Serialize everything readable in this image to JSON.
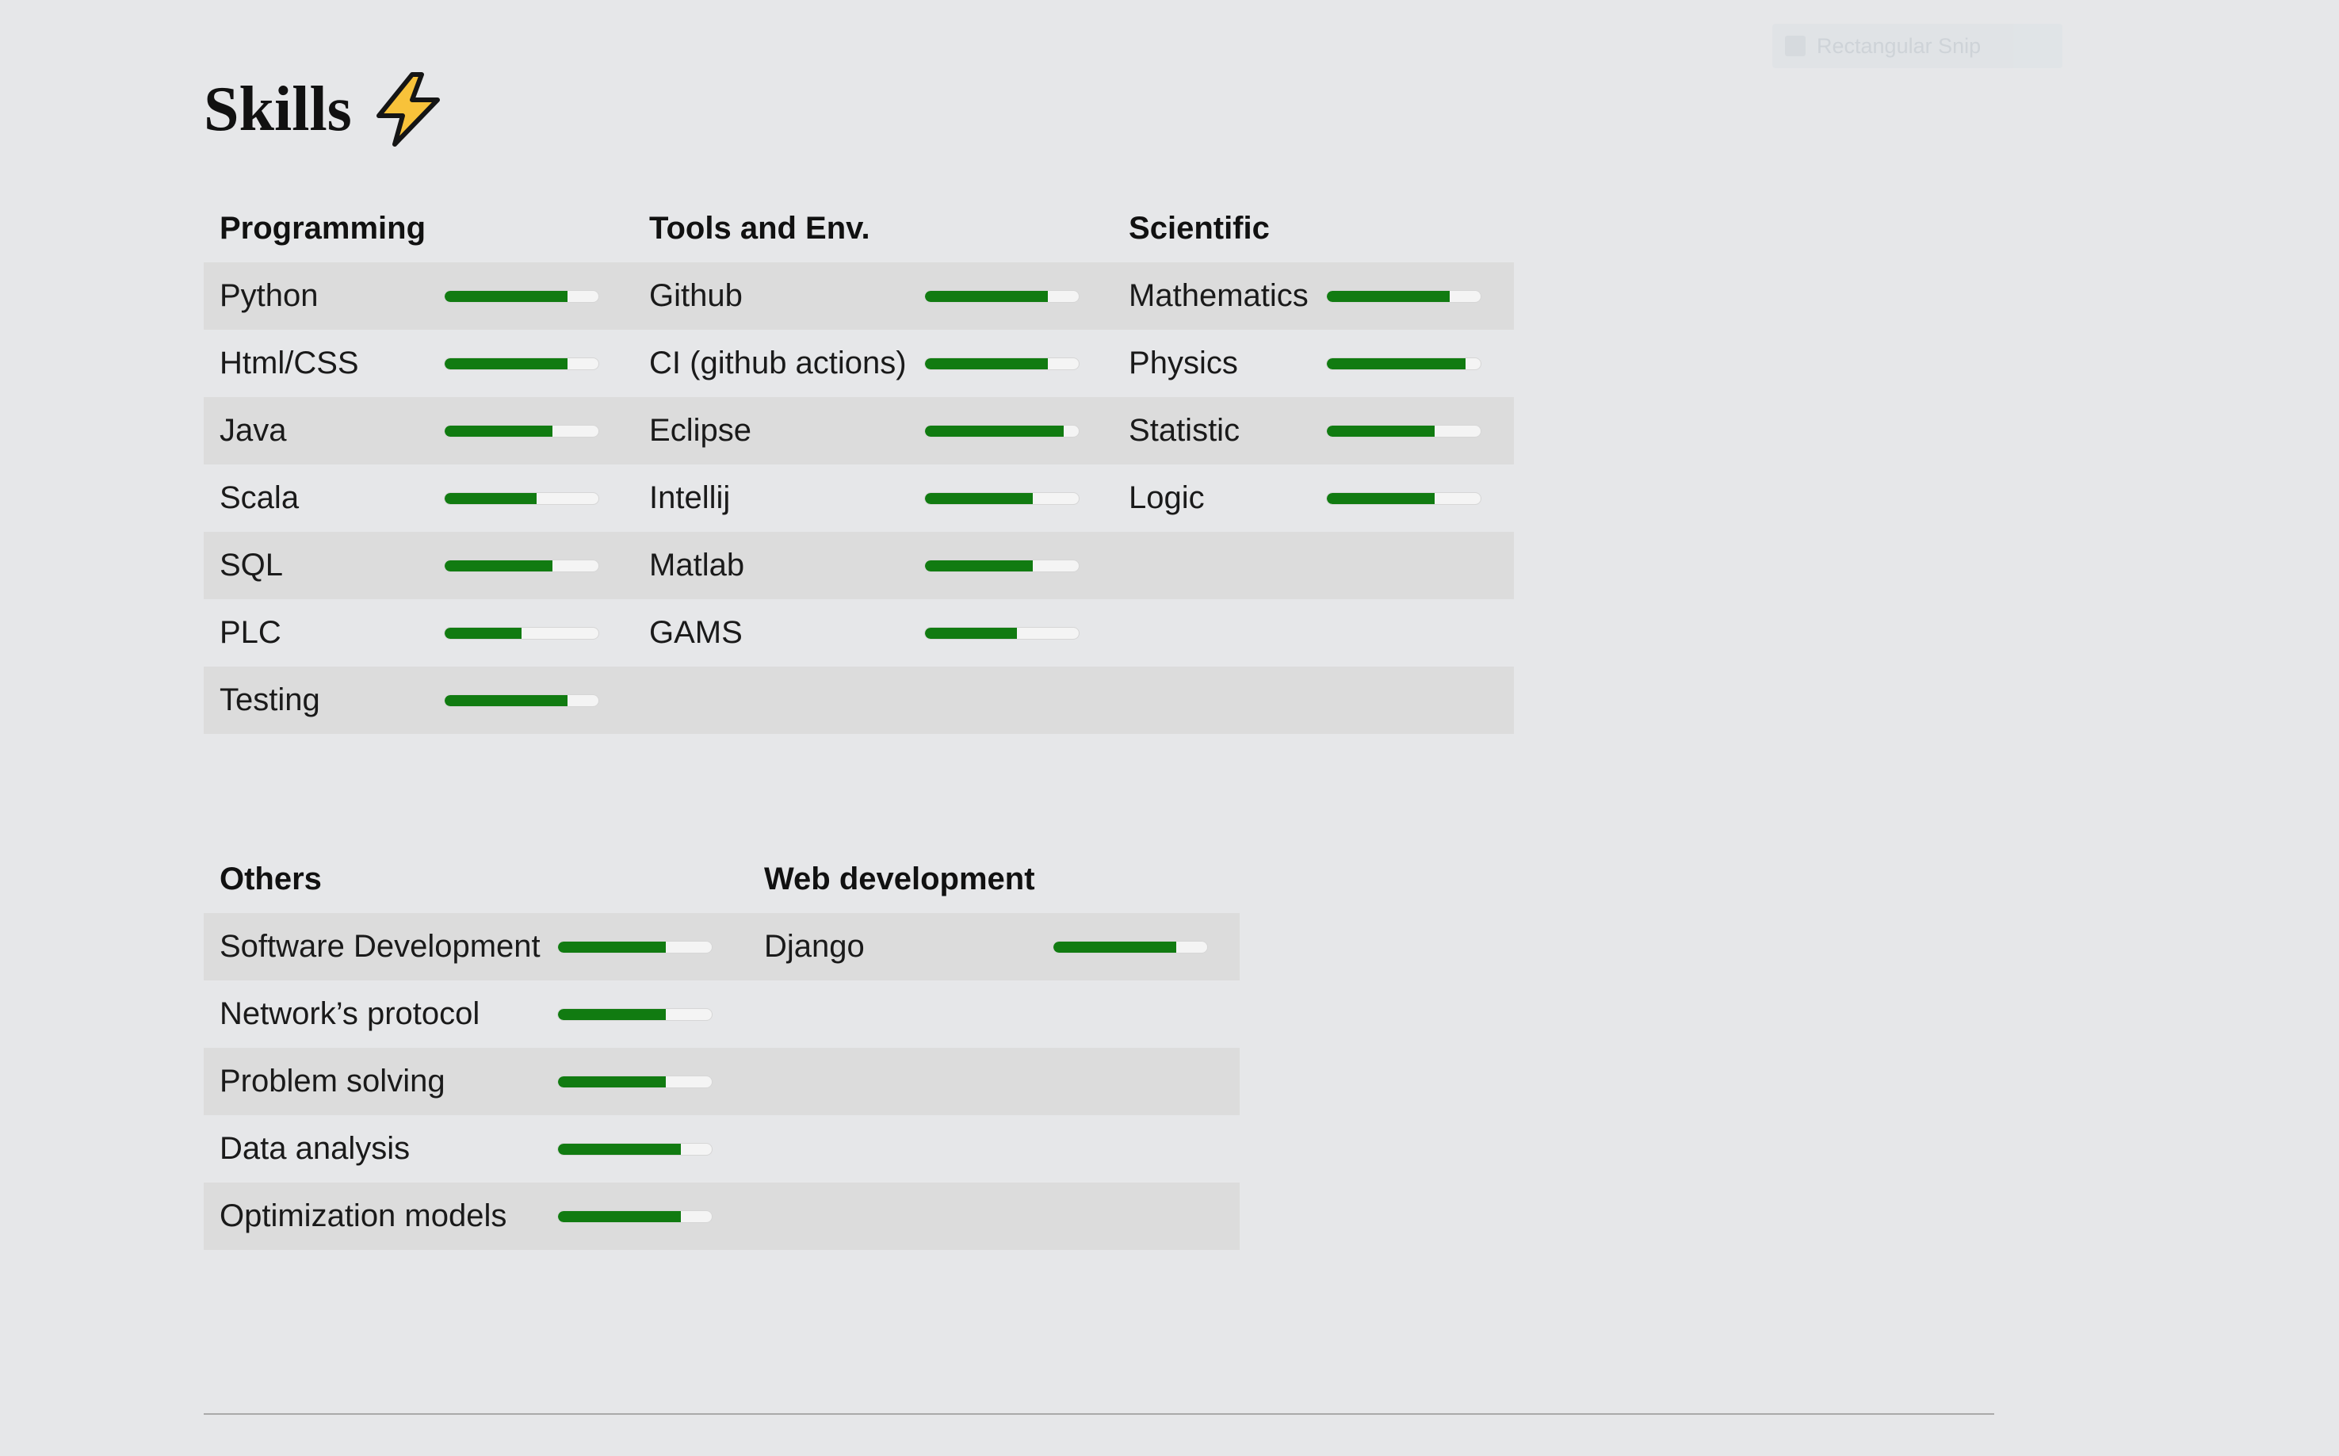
{
  "overlay": {
    "label": "Rectangular Snip"
  },
  "heading": {
    "title": "Skills",
    "icon": "lightning-bolt-icon"
  },
  "colors": {
    "bar_fill": "#117b11",
    "bar_track": "#f4f4f4",
    "background": "#e6e7e9",
    "row_shade": "#dcdcdc"
  },
  "groups_top": {
    "programming": {
      "title": "Programming",
      "skills": [
        {
          "name": "Python",
          "level": 0.8
        },
        {
          "name": "Html/CSS",
          "level": 0.8
        },
        {
          "name": "Java",
          "level": 0.7
        },
        {
          "name": "Scala",
          "level": 0.6
        },
        {
          "name": "SQL",
          "level": 0.7
        },
        {
          "name": "PLC",
          "level": 0.5
        },
        {
          "name": "Testing",
          "level": 0.8
        }
      ]
    },
    "tools": {
      "title": "Tools and Env.",
      "skills": [
        {
          "name": "Github",
          "level": 0.8
        },
        {
          "name": "CI (github actions)",
          "level": 0.8
        },
        {
          "name": "Eclipse",
          "level": 0.9
        },
        {
          "name": "Intellij",
          "level": 0.7
        },
        {
          "name": "Matlab",
          "level": 0.7
        },
        {
          "name": "GAMS",
          "level": 0.6
        }
      ]
    },
    "scientific": {
      "title": "Scientific",
      "skills": [
        {
          "name": "Mathematics",
          "level": 0.8
        },
        {
          "name": "Physics",
          "level": 0.9
        },
        {
          "name": "Statistic",
          "level": 0.7
        },
        {
          "name": "Logic",
          "level": 0.7
        }
      ]
    }
  },
  "groups_bottom": {
    "others": {
      "title": "Others",
      "skills": [
        {
          "name": "Software Development",
          "level": 0.7
        },
        {
          "name": "Network’s protocol",
          "level": 0.7
        },
        {
          "name": "Problem solving",
          "level": 0.7
        },
        {
          "name": "Data analysis",
          "level": 0.8
        },
        {
          "name": "Optimization models",
          "level": 0.8
        }
      ]
    },
    "web": {
      "title": "Web development",
      "skills": [
        {
          "name": "Django",
          "level": 0.8
        }
      ]
    }
  }
}
